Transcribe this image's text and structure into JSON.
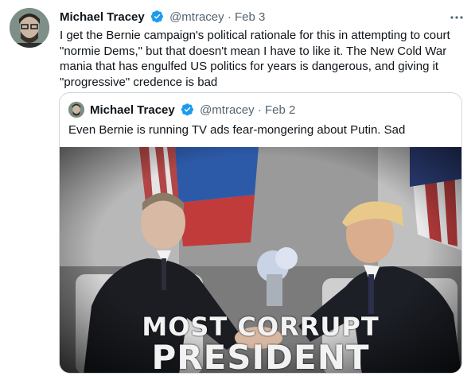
{
  "tweet": {
    "author_name": "Michael Tracey",
    "handle": "@mtracey",
    "separator": "·",
    "date": "Feb 3",
    "more_icon": "more-horizontal-icon",
    "text": "I get the Bernie campaign's political rationale for this in attempting to court \"normie Dems,\" but that doesn't mean I have to like it. The New Cold War mania that has engulfed US politics for years is dangerous, and giving it \"progressive\" credence is bad",
    "verified_color": "#1d9bf0"
  },
  "quoted_tweet": {
    "author_name": "Michael Tracey",
    "handle": "@mtracey",
    "separator": "·",
    "date": "Feb 2",
    "text": "Even Bernie is running TV ads fear-mongering about Putin. Sad",
    "media": {
      "banner_line1": "MOST CORRUPT",
      "banner_line2": "PRESIDENT"
    }
  }
}
